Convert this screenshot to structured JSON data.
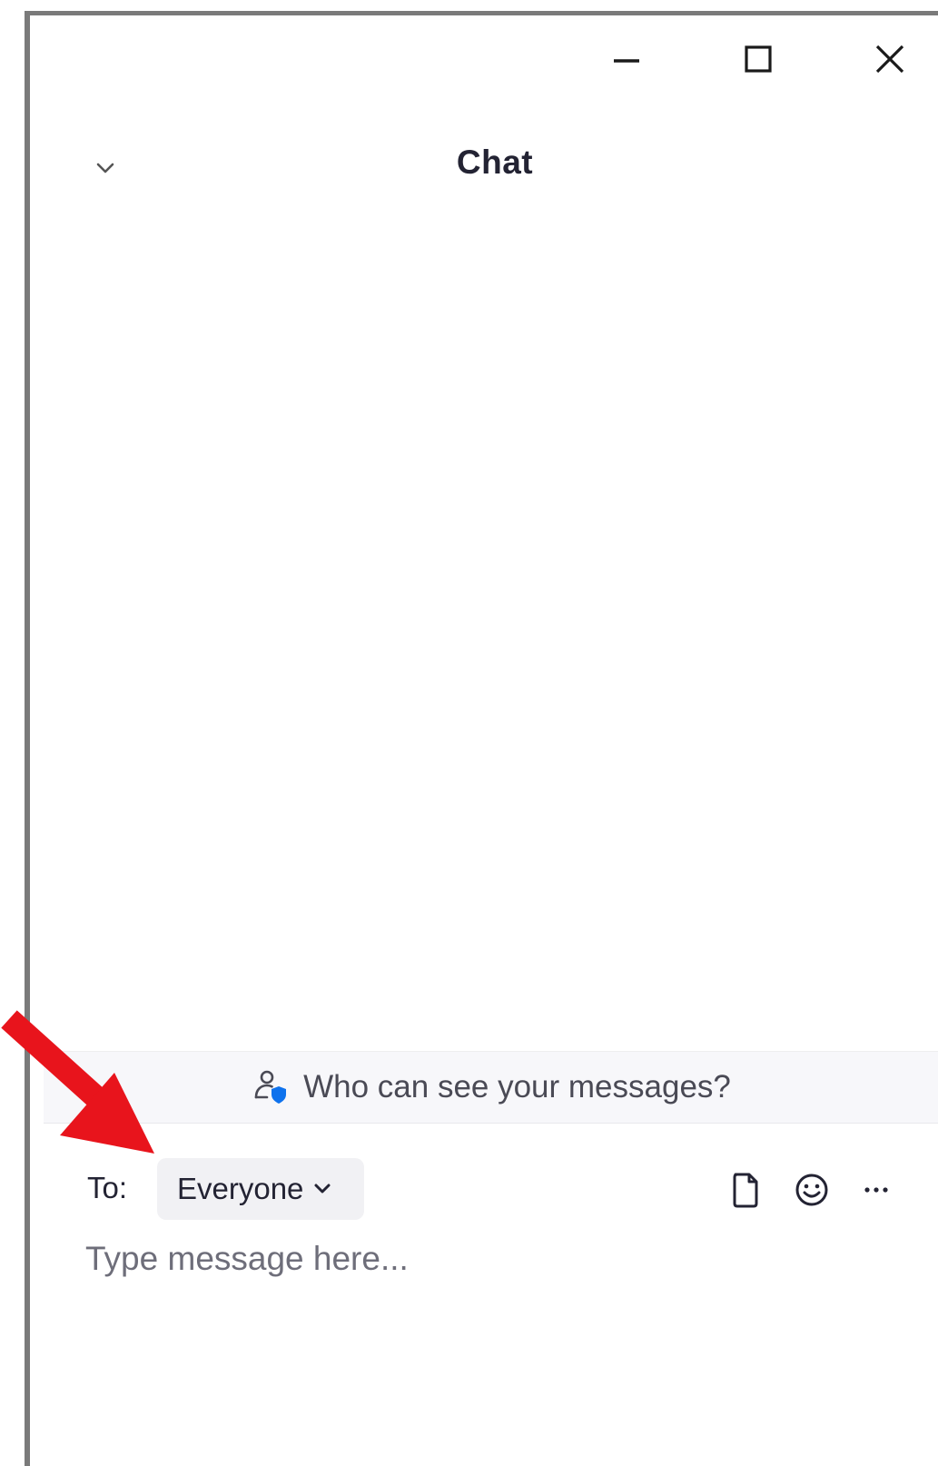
{
  "window": {
    "minimize_icon": "minimize-icon",
    "maximize_icon": "maximize-icon",
    "close_icon": "close-icon"
  },
  "header": {
    "title": "Chat",
    "collapse_icon": "chevron-down-icon"
  },
  "privacy_banner": {
    "text": "Who can see your messages?",
    "icon": "user-shield-icon",
    "icon_color": "#0e72ed"
  },
  "composer": {
    "to_label": "To:",
    "recipient": "Everyone",
    "recipient_icon": "chevron-down-icon",
    "tools": [
      "file-icon",
      "emoji-icon",
      "more-icon"
    ],
    "placeholder": "Type message here..."
  },
  "annotation": {
    "arrow_color": "#e8141c"
  }
}
